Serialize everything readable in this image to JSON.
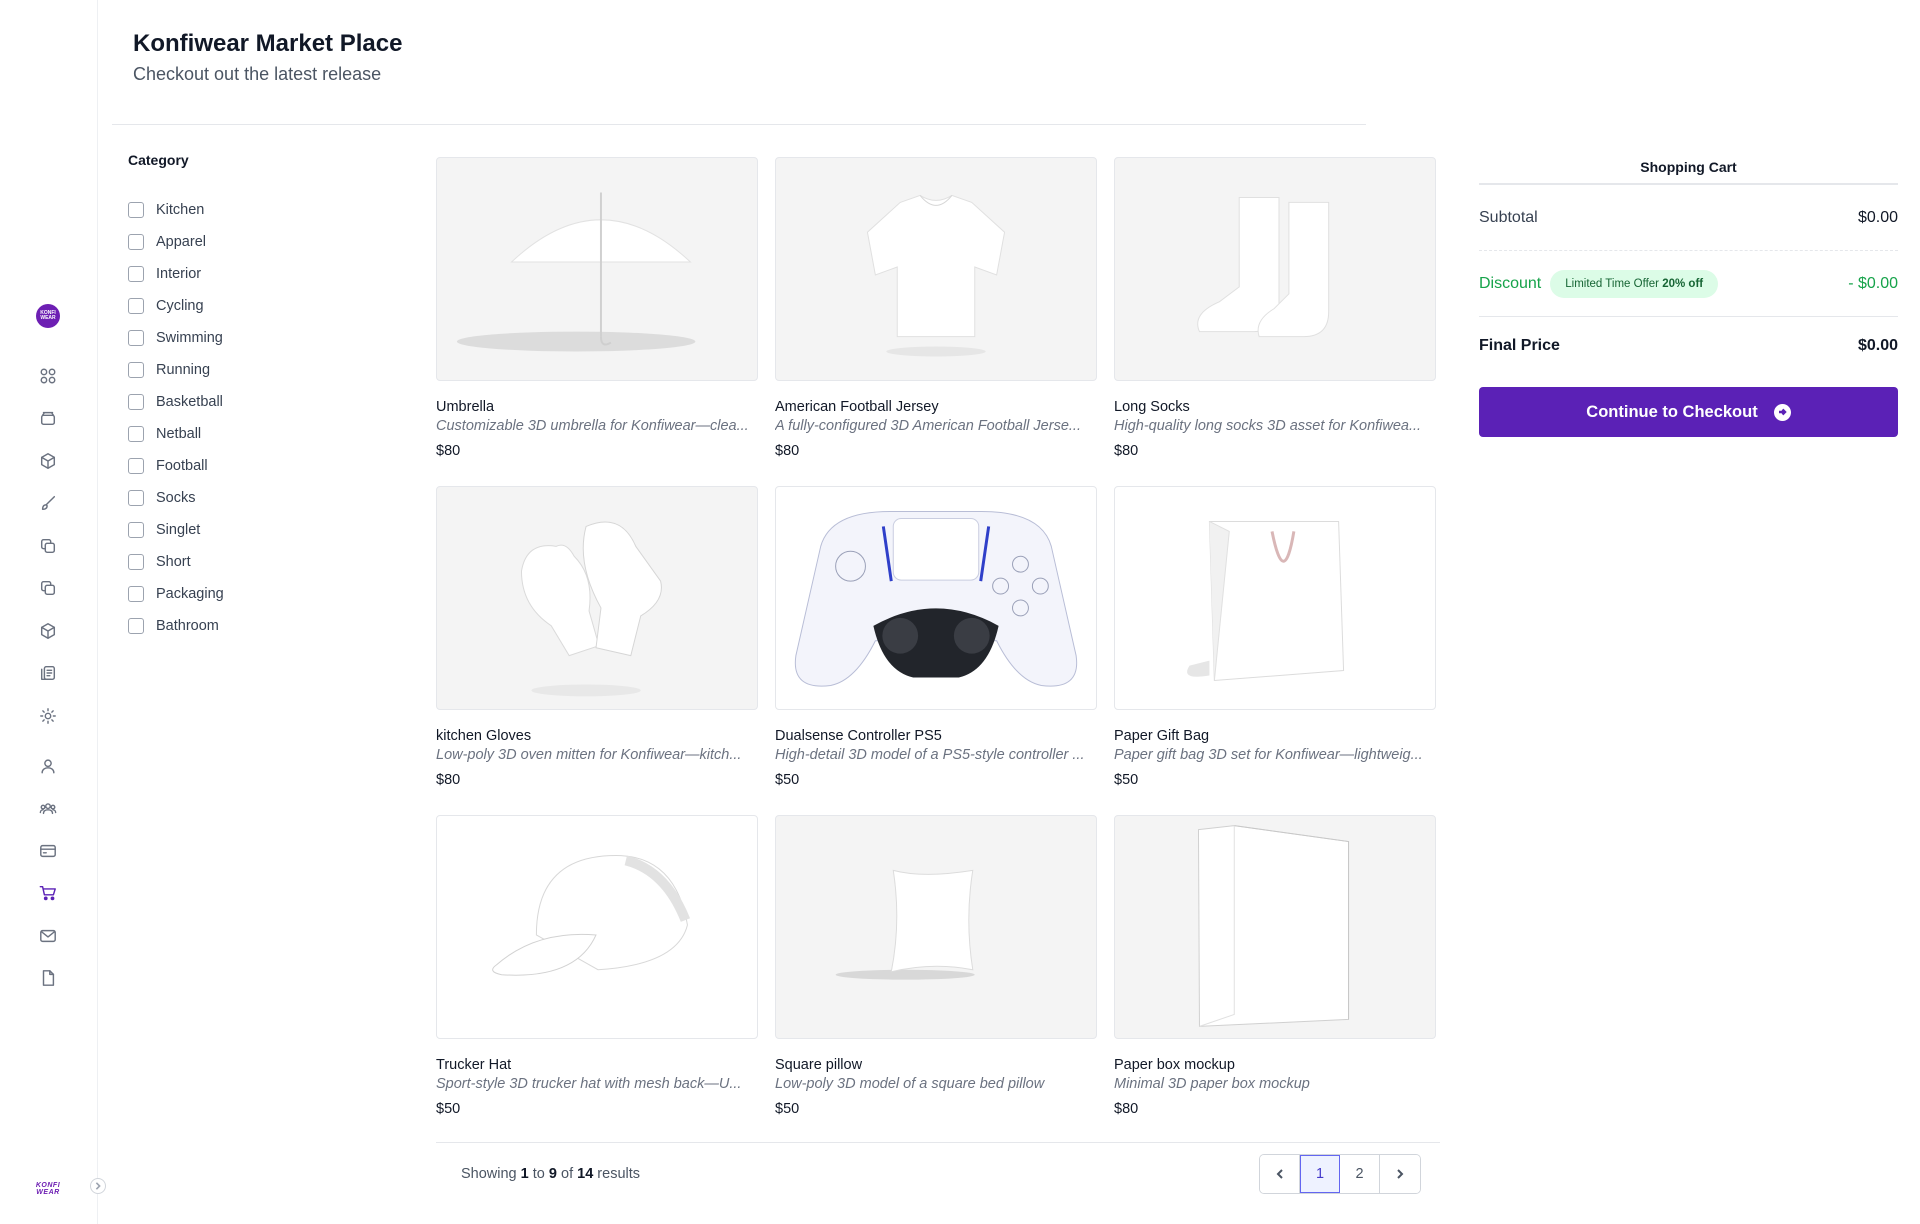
{
  "header": {
    "title": "Konfiwear Market Place",
    "subtitle": "Checkout out the latest release"
  },
  "brand": {
    "badge_text": "KONFI WEAR",
    "logo_text": "KONFI WEAR",
    "accent": "#5b21b6"
  },
  "sidebar": {
    "icons": [
      "dashboard-icon",
      "stack-icon",
      "box-icon",
      "brush-icon",
      "copy-icon",
      "duplicate-icon",
      "cube-icon",
      "clipboard-icon",
      "settings-icon",
      "user-icon",
      "team-icon",
      "credit-card-icon",
      "cart-icon",
      "mail-icon",
      "file-icon"
    ],
    "active": "cart-icon"
  },
  "filters": {
    "title": "Category",
    "categories": [
      "Kitchen",
      "Apparel",
      "Interior",
      "Cycling",
      "Swimming",
      "Running",
      "Basketball",
      "Netball",
      "Football",
      "Socks",
      "Singlet",
      "Short",
      "Packaging",
      "Bathroom"
    ]
  },
  "products": [
    {
      "name": "Umbrella",
      "description": "Customizable 3D umbrella for Konfiwear—clea...",
      "price": "$80"
    },
    {
      "name": "American Football Jersey",
      "description": "A fully-configured 3D American Football Jerse...",
      "price": "$80"
    },
    {
      "name": "Long Socks",
      "description": "High-quality long socks 3D asset for Konfiwea...",
      "price": "$80"
    },
    {
      "name": "kitchen Gloves",
      "description": "Low-poly 3D oven mitten for Konfiwear—kitch...",
      "price": "$80"
    },
    {
      "name": "Dualsense Controller PS5",
      "description": "High-detail 3D model of a PS5-style controller ...",
      "price": "$50"
    },
    {
      "name": "Paper Gift Bag",
      "description": "Paper gift bag 3D set for Konfiwear—lightweig...",
      "price": "$50"
    },
    {
      "name": "Trucker Hat",
      "description": "Sport-style 3D trucker hat with mesh back—U...",
      "price": "$50"
    },
    {
      "name": "Square pillow",
      "description": "Low-poly 3D model of a square bed pillow",
      "price": "$50"
    },
    {
      "name": "Paper box mockup",
      "description": "Minimal 3D paper box mockup",
      "price": "$80"
    }
  ],
  "pagination": {
    "prefix": "Showing",
    "from": "1",
    "to_word": "to",
    "to": "9",
    "of_word": "of",
    "total": "14",
    "suffix": "results",
    "pages": [
      "1",
      "2"
    ],
    "current": "1"
  },
  "cart": {
    "title": "Shopping Cart",
    "subtotal_label": "Subtotal",
    "subtotal_value": "$0.00",
    "discount_label": "Discount",
    "offer_text": "Limited Time Offer",
    "offer_percent": "20% off",
    "discount_value": "- $0.00",
    "final_label": "Final Price",
    "final_value": "$0.00",
    "checkout_label": "Continue to Checkout"
  }
}
